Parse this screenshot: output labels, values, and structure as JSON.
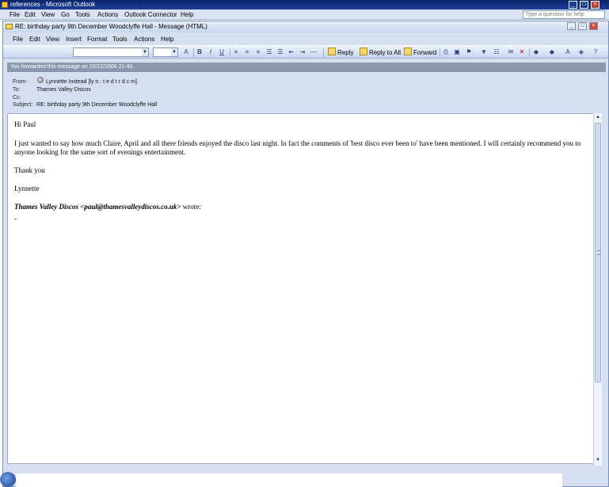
{
  "outer": {
    "title": "references - Microsoft Outlook",
    "menu": [
      "File",
      "Edit",
      "View",
      "Go",
      "Tools",
      "Actions",
      "Outlook Connector",
      "Help"
    ],
    "ask_placeholder": "Type a question for help"
  },
  "message_window": {
    "title": "RE: birthday party 9th December Woodclyffe Hall - Message (HTML)",
    "menu": [
      "File",
      "Edit",
      "View",
      "Insert",
      "Format",
      "Tools",
      "Actions",
      "Help"
    ],
    "toolbar": {
      "reply": "Reply",
      "reply_all": "Reply to All",
      "forward": "Forward"
    }
  },
  "info_bar": "You forwarded this message on 10/12/2006 21:40.",
  "header": {
    "from_label": "From:",
    "from_value": "Lynnette Instead [ly n  :  t  e  d  t  r  d  c  m]",
    "to_label": "To:",
    "to_value": "Thames Valley Discos",
    "cc_label": "Cc:",
    "cc_value": "",
    "subject_label": "Subject:",
    "subject_value": "RE: birthday party 9th December Woodclyffe Hall"
  },
  "body": {
    "greeting": "Hi Paul",
    "paragraph": "I just wanted to say how much Claire, April and all there friends enjoyed the disco last night.  In fact the comments of 'best disco ever been to' have been mentioned.  I will certainly recommend you to anyone looking for the same sort of evenings entertainment.",
    "thanks": "Thank you",
    "signature": "Lynnette",
    "quote_sender": "Thames Valley Discos <paul@thamesvalleydiscos.co.uk>",
    "quote_suffix": " wrote:",
    "quote_start": "-"
  }
}
